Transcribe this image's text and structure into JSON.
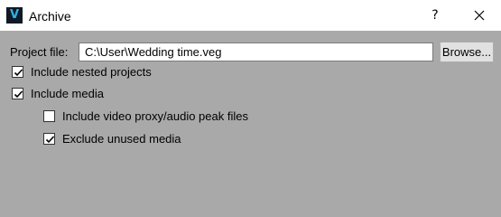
{
  "window": {
    "title": "Archive",
    "app_icon_glyph": "V",
    "help_glyph": "?",
    "close_icon": "close-icon"
  },
  "form": {
    "project_file_label": "Project file:",
    "project_file_value": "C:\\User\\Wedding time.veg",
    "browse_label": "Browse...",
    "include_nested": {
      "label": "Include nested projects",
      "checked": true
    },
    "include_media": {
      "label": "Include media",
      "checked": true
    },
    "include_proxy": {
      "label": "Include video proxy/audio peak files",
      "checked": false
    },
    "exclude_unused": {
      "label": "Exclude unused media",
      "checked": true
    }
  },
  "colors": {
    "dialog_background": "#a9a9a9",
    "titlebar_background": "#ffffff",
    "button_face": "#e1e1e1"
  }
}
